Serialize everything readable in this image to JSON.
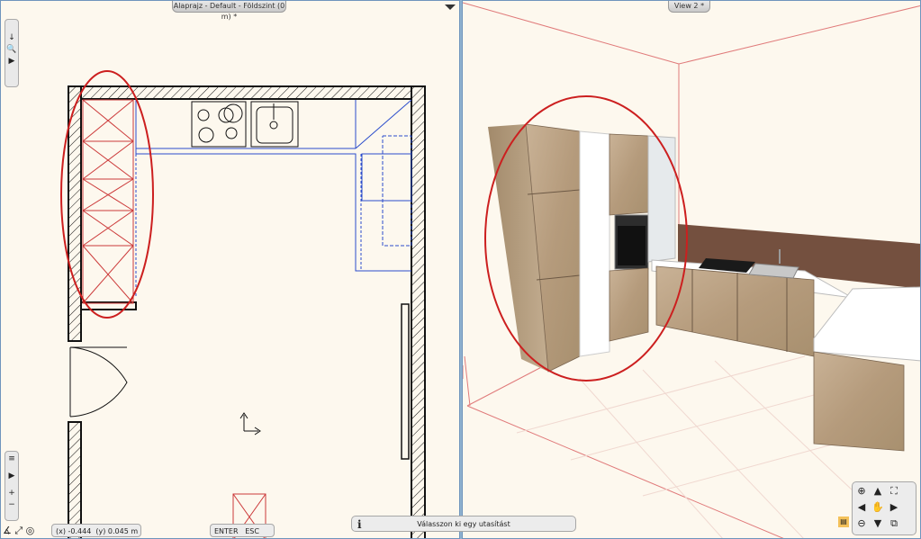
{
  "left_view": {
    "title": "Alaprajz - Default - Földszint (0 m) *"
  },
  "right_view": {
    "title": "View 2 *"
  },
  "toolbar_top": [
    "arrow-down-icon",
    "zoom-icon",
    "play-icon"
  ],
  "toolbar_bottom": [
    "list-icon",
    "play-icon",
    "plus-icon",
    "minus-icon"
  ],
  "coords": {
    "x_label": "(x) -0.444",
    "y_label": "(y) 0.045 m"
  },
  "keys": {
    "enter": "ENTER",
    "esc": "ESC"
  },
  "prompt": {
    "info_icon": "i",
    "text": "Válasszon ki egy utasítást"
  },
  "colors": {
    "pane_bg": "#fdf8ee",
    "wall": "#111111",
    "annotation": "#cc1f1f",
    "cabinet_blue": "#2b4dcc"
  }
}
